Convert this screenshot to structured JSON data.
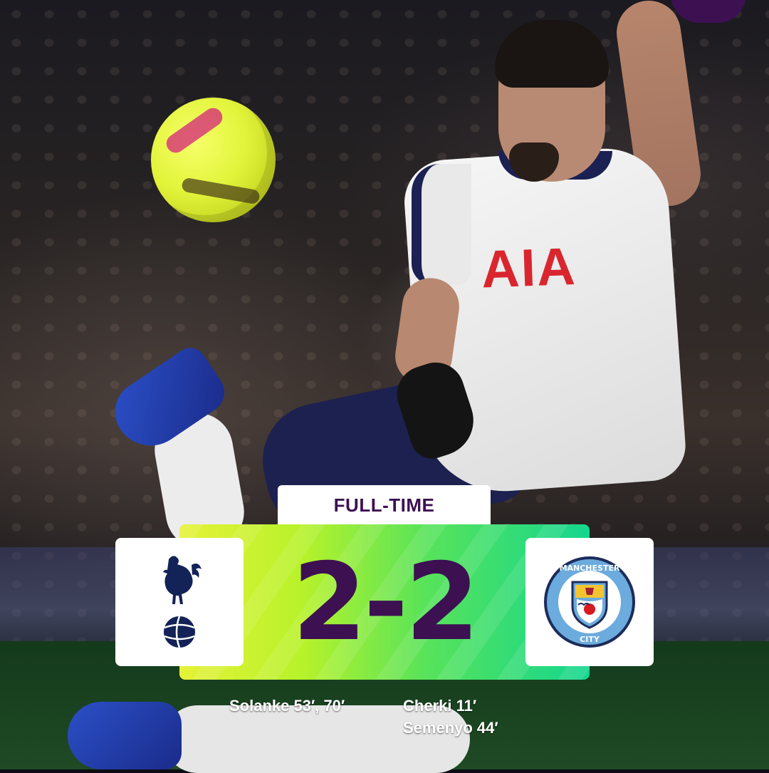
{
  "match": {
    "status": "FULL-TIME",
    "score": "2-2",
    "home": {
      "crest_icon": "tottenham-hotspur-crest-icon",
      "scorers": [
        "Solanke 53′, 70′"
      ]
    },
    "away": {
      "crest_icon": "manchester-city-crest-icon",
      "scorers": [
        "Cherki 11′",
        "Semenyo 44′"
      ]
    }
  },
  "photo": {
    "sponsor_text": "AIA"
  },
  "colors": {
    "brand_purple": "#3d1052",
    "panel_gradient_start": "#e6f238",
    "panel_gradient_end": "#14d68f",
    "spurs_navy": "#132257",
    "city_blue": "#6cabdd"
  },
  "icons": {
    "league_logo": "premier-league-logo-icon",
    "ball": "football-icon"
  }
}
